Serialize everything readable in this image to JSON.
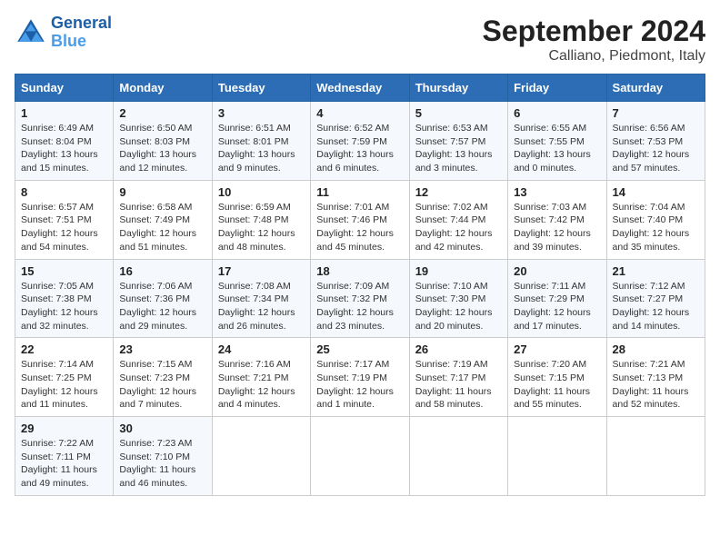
{
  "logo": {
    "line1": "General",
    "line2": "Blue"
  },
  "title": "September 2024",
  "subtitle": "Calliano, Piedmont, Italy",
  "days_header": [
    "Sunday",
    "Monday",
    "Tuesday",
    "Wednesday",
    "Thursday",
    "Friday",
    "Saturday"
  ],
  "weeks": [
    [
      {
        "day": "1",
        "info": "Sunrise: 6:49 AM\nSunset: 8:04 PM\nDaylight: 13 hours\nand 15 minutes."
      },
      {
        "day": "2",
        "info": "Sunrise: 6:50 AM\nSunset: 8:03 PM\nDaylight: 13 hours\nand 12 minutes."
      },
      {
        "day": "3",
        "info": "Sunrise: 6:51 AM\nSunset: 8:01 PM\nDaylight: 13 hours\nand 9 minutes."
      },
      {
        "day": "4",
        "info": "Sunrise: 6:52 AM\nSunset: 7:59 PM\nDaylight: 13 hours\nand 6 minutes."
      },
      {
        "day": "5",
        "info": "Sunrise: 6:53 AM\nSunset: 7:57 PM\nDaylight: 13 hours\nand 3 minutes."
      },
      {
        "day": "6",
        "info": "Sunrise: 6:55 AM\nSunset: 7:55 PM\nDaylight: 13 hours\nand 0 minutes."
      },
      {
        "day": "7",
        "info": "Sunrise: 6:56 AM\nSunset: 7:53 PM\nDaylight: 12 hours\nand 57 minutes."
      }
    ],
    [
      {
        "day": "8",
        "info": "Sunrise: 6:57 AM\nSunset: 7:51 PM\nDaylight: 12 hours\nand 54 minutes."
      },
      {
        "day": "9",
        "info": "Sunrise: 6:58 AM\nSunset: 7:49 PM\nDaylight: 12 hours\nand 51 minutes."
      },
      {
        "day": "10",
        "info": "Sunrise: 6:59 AM\nSunset: 7:48 PM\nDaylight: 12 hours\nand 48 minutes."
      },
      {
        "day": "11",
        "info": "Sunrise: 7:01 AM\nSunset: 7:46 PM\nDaylight: 12 hours\nand 45 minutes."
      },
      {
        "day": "12",
        "info": "Sunrise: 7:02 AM\nSunset: 7:44 PM\nDaylight: 12 hours\nand 42 minutes."
      },
      {
        "day": "13",
        "info": "Sunrise: 7:03 AM\nSunset: 7:42 PM\nDaylight: 12 hours\nand 39 minutes."
      },
      {
        "day": "14",
        "info": "Sunrise: 7:04 AM\nSunset: 7:40 PM\nDaylight: 12 hours\nand 35 minutes."
      }
    ],
    [
      {
        "day": "15",
        "info": "Sunrise: 7:05 AM\nSunset: 7:38 PM\nDaylight: 12 hours\nand 32 minutes."
      },
      {
        "day": "16",
        "info": "Sunrise: 7:06 AM\nSunset: 7:36 PM\nDaylight: 12 hours\nand 29 minutes."
      },
      {
        "day": "17",
        "info": "Sunrise: 7:08 AM\nSunset: 7:34 PM\nDaylight: 12 hours\nand 26 minutes."
      },
      {
        "day": "18",
        "info": "Sunrise: 7:09 AM\nSunset: 7:32 PM\nDaylight: 12 hours\nand 23 minutes."
      },
      {
        "day": "19",
        "info": "Sunrise: 7:10 AM\nSunset: 7:30 PM\nDaylight: 12 hours\nand 20 minutes."
      },
      {
        "day": "20",
        "info": "Sunrise: 7:11 AM\nSunset: 7:29 PM\nDaylight: 12 hours\nand 17 minutes."
      },
      {
        "day": "21",
        "info": "Sunrise: 7:12 AM\nSunset: 7:27 PM\nDaylight: 12 hours\nand 14 minutes."
      }
    ],
    [
      {
        "day": "22",
        "info": "Sunrise: 7:14 AM\nSunset: 7:25 PM\nDaylight: 12 hours\nand 11 minutes."
      },
      {
        "day": "23",
        "info": "Sunrise: 7:15 AM\nSunset: 7:23 PM\nDaylight: 12 hours\nand 7 minutes."
      },
      {
        "day": "24",
        "info": "Sunrise: 7:16 AM\nSunset: 7:21 PM\nDaylight: 12 hours\nand 4 minutes."
      },
      {
        "day": "25",
        "info": "Sunrise: 7:17 AM\nSunset: 7:19 PM\nDaylight: 12 hours\nand 1 minute."
      },
      {
        "day": "26",
        "info": "Sunrise: 7:19 AM\nSunset: 7:17 PM\nDaylight: 11 hours\nand 58 minutes."
      },
      {
        "day": "27",
        "info": "Sunrise: 7:20 AM\nSunset: 7:15 PM\nDaylight: 11 hours\nand 55 minutes."
      },
      {
        "day": "28",
        "info": "Sunrise: 7:21 AM\nSunset: 7:13 PM\nDaylight: 11 hours\nand 52 minutes."
      }
    ],
    [
      {
        "day": "29",
        "info": "Sunrise: 7:22 AM\nSunset: 7:11 PM\nDaylight: 11 hours\nand 49 minutes."
      },
      {
        "day": "30",
        "info": "Sunrise: 7:23 AM\nSunset: 7:10 PM\nDaylight: 11 hours\nand 46 minutes."
      },
      null,
      null,
      null,
      null,
      null
    ]
  ]
}
